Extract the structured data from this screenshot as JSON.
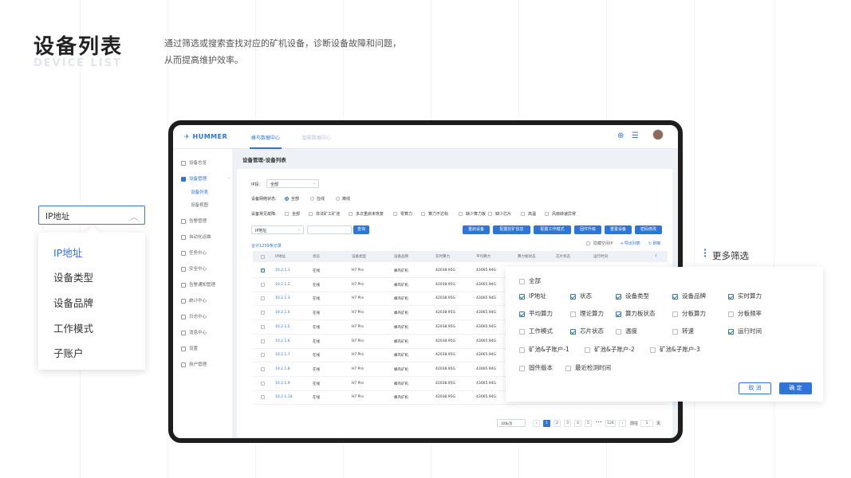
{
  "page": {
    "title": "设备列表",
    "subtitle": "DEVICE LIST",
    "description_lines": [
      "通过筛选或搜索查找对应的矿机设备，诊断设备故障和问题，",
      "从而提高维护效率。"
    ]
  },
  "dropdown": {
    "selected": "IP地址",
    "options": [
      "IP地址",
      "设备类型",
      "设备品牌",
      "工作模式",
      "子账户"
    ]
  },
  "app": {
    "logo": "HUMMER",
    "nav": [
      "蜂鸟数据中心",
      "智能数据中心"
    ],
    "page_title": "设备管理-设备列表",
    "sidebar": [
      {
        "label": "设备总览"
      },
      {
        "label": "设备管理",
        "children": [
          "设备列表",
          "设备视图"
        ]
      },
      {
        "label": "告警管理"
      },
      {
        "label": "自动化运维"
      },
      {
        "label": "任务中心"
      },
      {
        "label": "安全中心"
      },
      {
        "label": "告警通知管理"
      },
      {
        "label": "统计中心"
      },
      {
        "label": "日志中心"
      },
      {
        "label": "消息中心"
      },
      {
        "label": "设置"
      },
      {
        "label": "用户管理"
      }
    ],
    "filters": {
      "pool_label": "IP段:",
      "pool_value": "全部",
      "online_label": "设备网络状态:",
      "online_options": [
        "全部",
        "在线",
        "离线"
      ],
      "fault_label": "设备常见故障:",
      "fault_options": [
        "全部",
        "非法矿工矿池",
        "多次重启未恢复",
        "零算力",
        "算力不达标",
        "缺少算力板",
        "缺少芯片",
        "高温",
        "风扇转速异常"
      ]
    },
    "search": {
      "field": "IP地址",
      "placeholder": "",
      "button": "查询"
    },
    "actions": [
      "重启设备",
      "配置挖矿信息",
      "配置工作模式",
      "固件升级",
      "重置设备",
      "密码修改"
    ],
    "total": "合计1239条记录",
    "tools": [
      "隐藏空闲IP",
      "导出列表",
      "刷新"
    ],
    "columns": [
      "IP地址",
      "状态",
      "设备类型",
      "设备品牌",
      "实时算力",
      "平均算力",
      "算力板状态",
      "芯片状态",
      "运行时间"
    ],
    "rows": [
      {
        "ip": "10.2.1.1",
        "status": "在线",
        "type": "H7 Pro",
        "brand": "蜂鸟矿机",
        "rt": "42038.95G",
        "avg": "43065.94G",
        "checked": true
      },
      {
        "ip": "10.2.1.2",
        "status": "在线",
        "type": "H7 Pro",
        "brand": "蜂鸟矿机",
        "rt": "42038.95G",
        "avg": "43065.94G",
        "checked": false
      },
      {
        "ip": "10.2.1.3",
        "status": "在线",
        "type": "H7 Pro",
        "brand": "蜂鸟矿机",
        "rt": "42038.95G",
        "avg": "43065.94G",
        "checked": false
      },
      {
        "ip": "10.2.1.4",
        "status": "在线",
        "type": "H7 Pro",
        "brand": "蜂鸟矿机",
        "rt": "42038.95G",
        "avg": "43065.94G",
        "checked": false
      },
      {
        "ip": "10.2.1.5",
        "status": "在线",
        "type": "H7 Pro",
        "brand": "蜂鸟矿机",
        "rt": "42038.95G",
        "avg": "43065.94G",
        "checked": false
      },
      {
        "ip": "10.2.1.6",
        "status": "在线",
        "type": "H7 Pro",
        "brand": "蜂鸟矿机",
        "rt": "42038.95G",
        "avg": "43065.94G",
        "checked": false
      },
      {
        "ip": "10.2.1.7",
        "status": "在线",
        "type": "H7 Pro",
        "brand": "蜂鸟矿机",
        "rt": "42038.95G",
        "avg": "43065.94G",
        "checked": false
      },
      {
        "ip": "10.2.1.8",
        "status": "在线",
        "type": "H7 Pro",
        "brand": "蜂鸟矿机",
        "rt": "42038.95G",
        "avg": "43065.94G",
        "checked": false
      },
      {
        "ip": "10.2.1.9",
        "status": "在线",
        "type": "H7 Pro",
        "brand": "蜂鸟矿机",
        "rt": "42038.95G",
        "avg": "43065.94G",
        "checked": false
      },
      {
        "ip": "10.2.1.10",
        "status": "在线",
        "type": "H7 Pro",
        "brand": "蜂鸟矿机",
        "rt": "42038.95G",
        "avg": "43065.94G",
        "checked": false
      }
    ],
    "pagination": {
      "page_size": "10条/页",
      "pages": [
        "1",
        "2",
        "3",
        "4",
        "5",
        "•••",
        "124"
      ],
      "current": "1",
      "goto_label": "前往",
      "goto_value": "1",
      "goto_suffix": "页"
    }
  },
  "more_filters": {
    "title": "更多筛选",
    "all": "全部",
    "items": [
      {
        "label": "IP地址",
        "checked": true
      },
      {
        "label": "状态",
        "checked": true
      },
      {
        "label": "设备类型",
        "checked": true
      },
      {
        "label": "设备品牌",
        "checked": true
      },
      {
        "label": "实时算力",
        "checked": true
      },
      {
        "label": "平均算力",
        "checked": true
      },
      {
        "label": "理论算力",
        "checked": false
      },
      {
        "label": "算力板状态",
        "checked": true
      },
      {
        "label": "分板算力",
        "checked": false
      },
      {
        "label": "分板频率",
        "checked": false
      },
      {
        "label": "工作模式",
        "checked": false
      },
      {
        "label": "芯片状态",
        "checked": true
      },
      {
        "label": "温度",
        "checked": false
      },
      {
        "label": "转速",
        "checked": false
      },
      {
        "label": "运行时间",
        "checked": true
      }
    ],
    "pool_items": [
      "矿池&子账户-1",
      "矿池&子账户-2",
      "矿池&子账户-3"
    ],
    "extra_items": [
      "固件版本",
      "最近检测时间"
    ],
    "cancel": "取 消",
    "confirm": "确 定"
  },
  "colors": {
    "accent": "#2f74d8",
    "device_frame": "#1e1e1e"
  }
}
